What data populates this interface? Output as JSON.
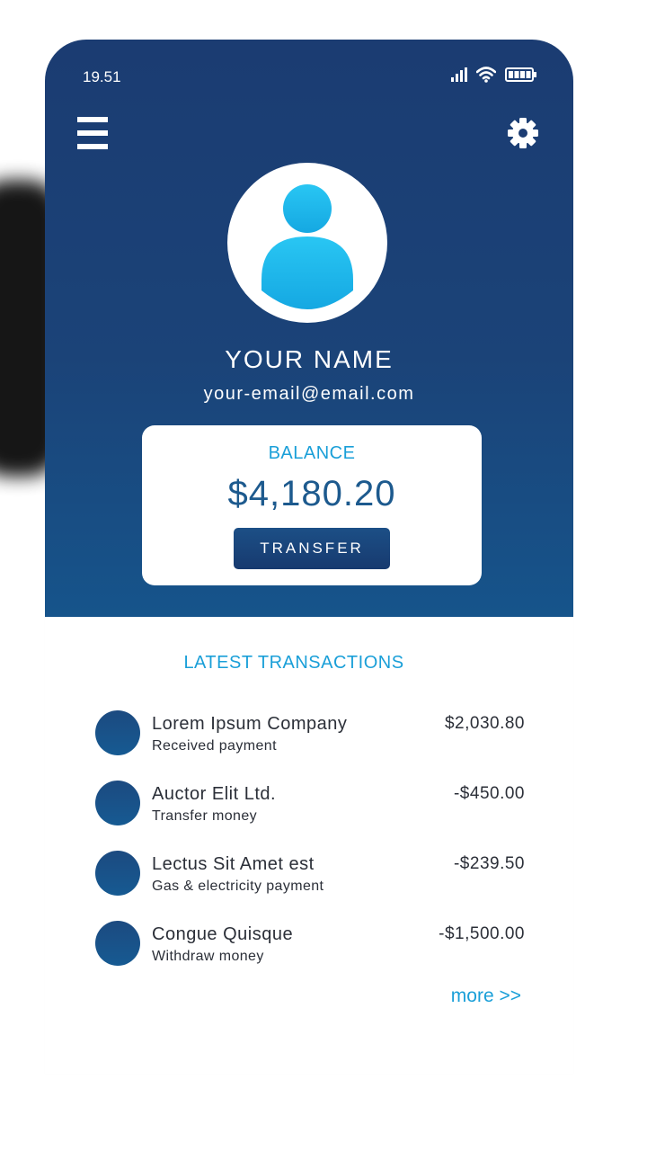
{
  "status_bar": {
    "time": "19.51"
  },
  "icons": {
    "menu": "menu-icon",
    "settings": "gear-icon",
    "avatar": "user-icon",
    "signal": "signal-icon",
    "wifi": "wifi-icon",
    "battery": "battery-icon"
  },
  "profile": {
    "name": "YOUR NAME",
    "email": "your-email@email.com"
  },
  "balance": {
    "label": "BALANCE",
    "value": "$4,180.20",
    "button_label": "TRANSFER"
  },
  "transactions": {
    "title": "LATEST TRANSACTIONS",
    "items": [
      {
        "name": "Lorem Ipsum Company",
        "description": "Received payment",
        "amount": "$2,030.80"
      },
      {
        "name": "Auctor Elit Ltd.",
        "description": "Transfer money",
        "amount": "-$450.00"
      },
      {
        "name": "Lectus Sit Amet est",
        "description": "Gas & electricity payment",
        "amount": "-$239.50"
      },
      {
        "name": "Congue Quisque",
        "description": "Withdraw money",
        "amount": "-$1,500.00"
      }
    ],
    "more_label": "more >>"
  },
  "colors": {
    "header_dark": "#1b3c72",
    "header_light": "#16548b",
    "accent": "#1a9fd8",
    "balance_text": "#1d5a8e",
    "avatar_blue": "#1fb3ea",
    "text": "#2b2f38"
  }
}
